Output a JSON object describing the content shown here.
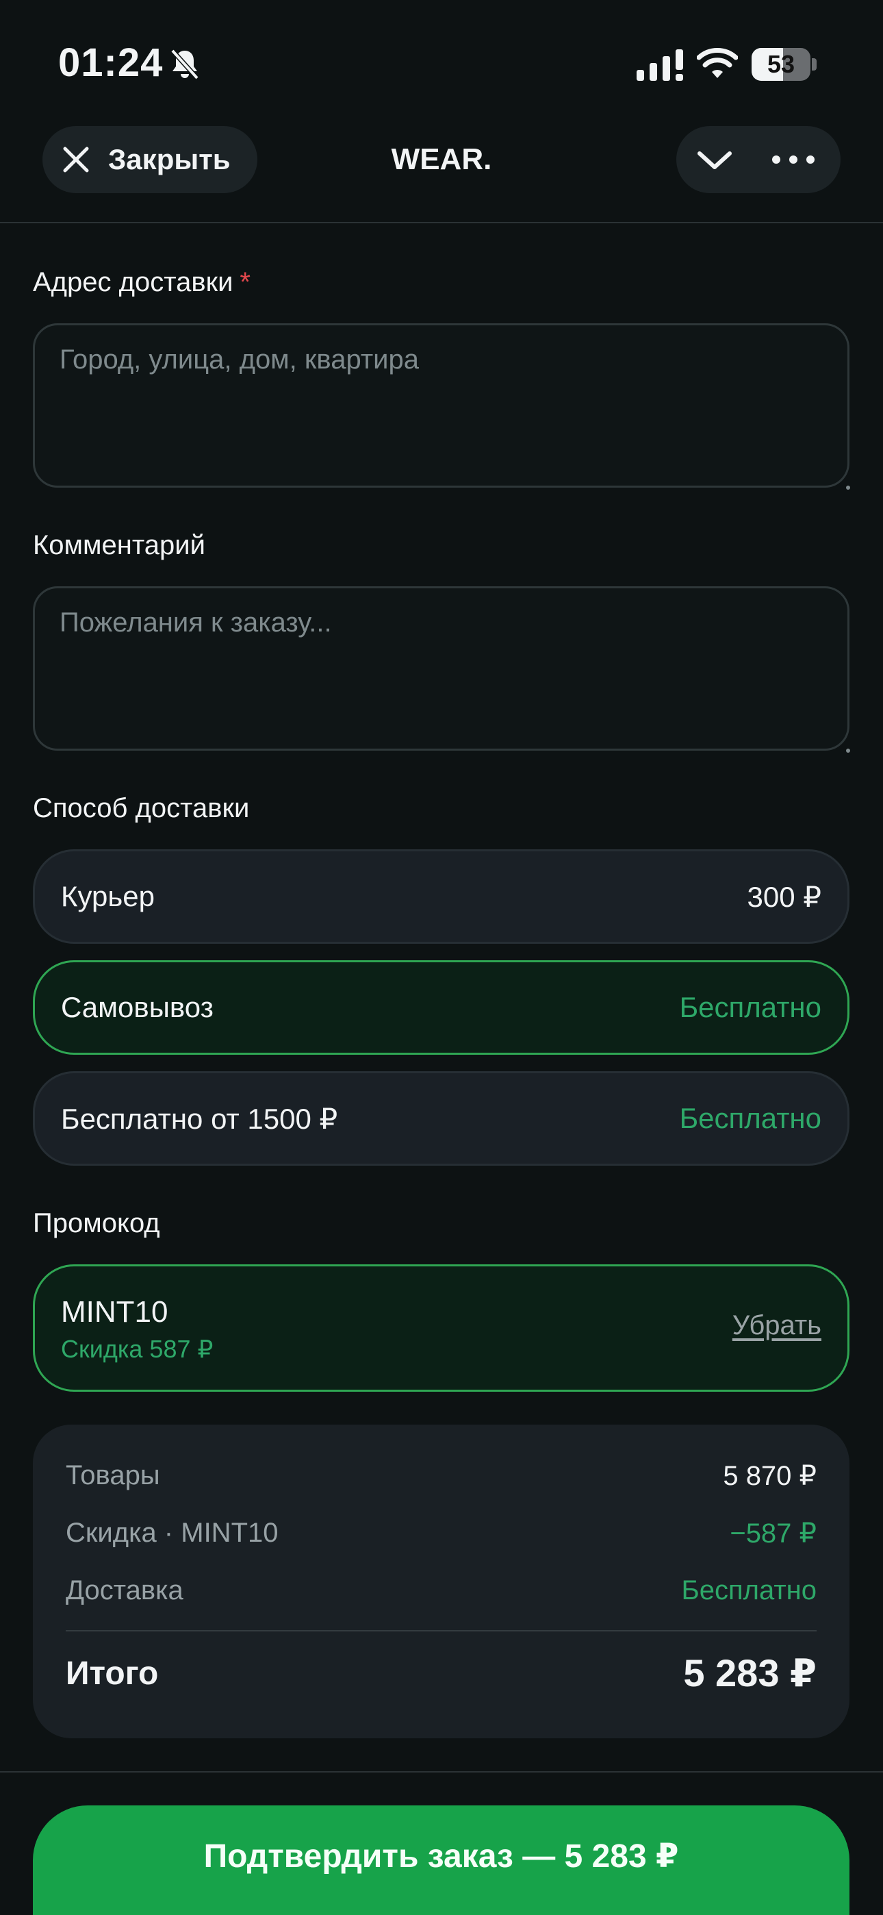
{
  "status_bar": {
    "time": "01:24",
    "battery_percent": "53",
    "battery_level": 0.53,
    "icons": [
      "bell-slash-icon",
      "signal-icon",
      "wifi-icon",
      "battery-icon"
    ]
  },
  "header": {
    "close_label": "Закрыть",
    "title": "WEAR.",
    "icons": [
      "close-icon",
      "chevron-down-icon",
      "more-icon"
    ]
  },
  "form": {
    "address": {
      "label": "Адрес доставки",
      "required_mark": "*",
      "value": "",
      "placeholder": "Город, улица, дом, квартира"
    },
    "comment": {
      "label": "Комментарий",
      "value": "",
      "placeholder": "Пожелания к заказу..."
    }
  },
  "delivery": {
    "label": "Способ доставки",
    "selected_index": 1,
    "options": [
      {
        "name": "Курьер",
        "price": "300 ₽"
      },
      {
        "name": "Самовывоз",
        "price": "Бесплатно"
      },
      {
        "name": "Бесплатно от 1500 ₽",
        "price": "Бесплатно"
      }
    ]
  },
  "promo": {
    "label": "Промокод",
    "code": "MINT10",
    "discount_text": "Скидка 587 ₽",
    "remove_label": "Убрать"
  },
  "summary": {
    "rows": [
      {
        "key": "Товары",
        "value": "5 870 ₽"
      },
      {
        "key": "Скидка · MINT10",
        "value": "−587 ₽"
      },
      {
        "key": "Доставка",
        "value": "Бесплатно"
      }
    ],
    "total_label": "Итого",
    "total_value": "5 283 ₽"
  },
  "confirm_label": "Подтвердить заказ — 5 283 ₽",
  "colors": {
    "background": "#0d1213",
    "accent_green": "#17a34a",
    "text_green": "#2ea869",
    "required_red": "#e5484d"
  }
}
